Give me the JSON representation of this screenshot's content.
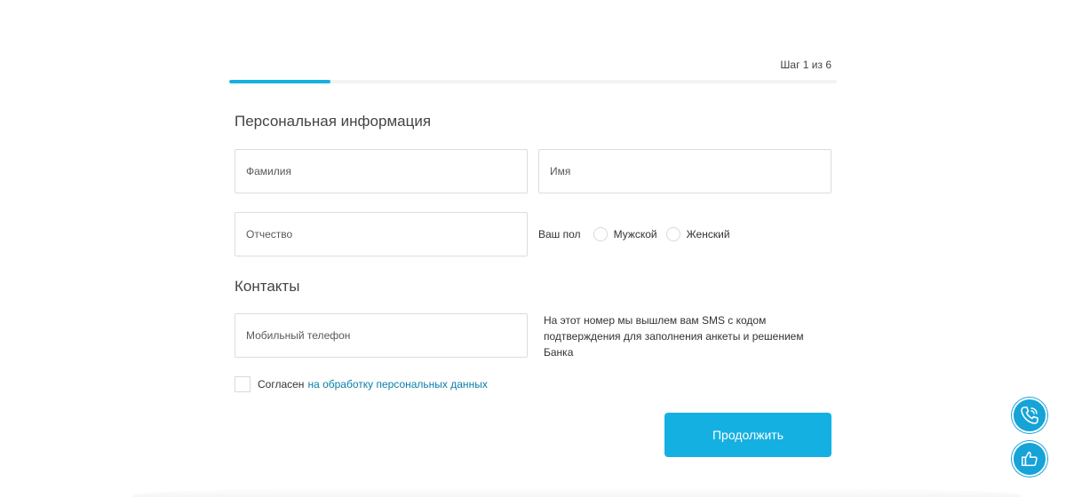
{
  "progress": {
    "step_text": "Шаг 1 из 6",
    "fraction": 0.1667
  },
  "sections": {
    "personal_title": "Персональная информация",
    "contacts_title": "Контакты"
  },
  "fields": {
    "last_name": {
      "placeholder": "Фамилия",
      "value": ""
    },
    "first_name": {
      "placeholder": "Имя",
      "value": ""
    },
    "middle_name": {
      "placeholder": "Отчество",
      "value": ""
    },
    "phone": {
      "placeholder": "Мобильный телефон",
      "value": ""
    }
  },
  "gender": {
    "label": "Ваш пол",
    "options": [
      "Мужской",
      "Женский"
    ]
  },
  "phone_hint": "На этот номер мы вышлем вам SMS с кодом подтверждения для заполнения анкеты и решением Банка",
  "consent": {
    "text": "Согласен",
    "link_text": "на обработку персональных данных"
  },
  "continue_label": "Продолжить",
  "floating": {
    "call_icon": "phone-icon",
    "feedback_icon": "thumbs-up-icon"
  },
  "colors": {
    "accent": "#15b0e2",
    "link": "#0a7ea8",
    "float": "#15a3d8"
  }
}
